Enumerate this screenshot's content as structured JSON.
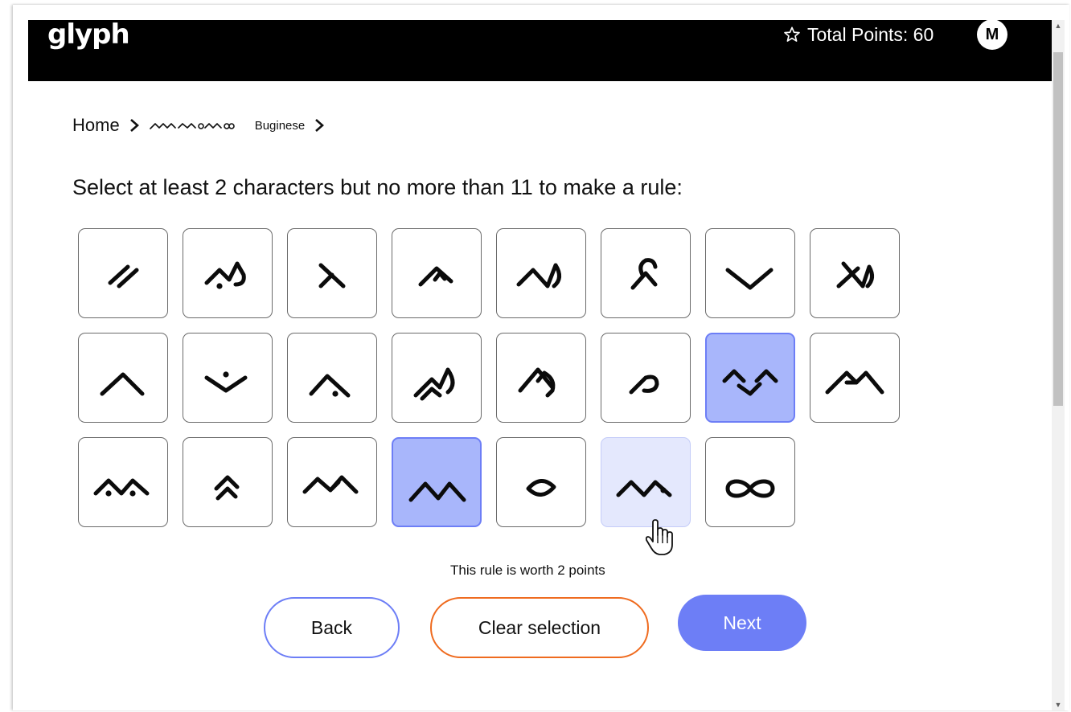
{
  "header": {
    "logo": "glyph",
    "points_label": "Total Points: 60",
    "avatar_initial": "M",
    "star_icon": "star-outline-icon"
  },
  "breadcrumb": {
    "home": "Home",
    "script_native": "ᨔᨗᨀᨘᨍᨁᨙ",
    "script_name": "Buginese",
    "chevron_icon": "chevron-right-icon"
  },
  "instruction": "Select at least 2 characters but no more than 11 to make a rule:",
  "tiles": [
    {
      "glyph": "double-slash",
      "state": "default"
    },
    {
      "glyph": "dot-hook",
      "state": "default"
    },
    {
      "glyph": "lambda",
      "state": "default"
    },
    {
      "glyph": "arrow-hat",
      "state": "default"
    },
    {
      "glyph": "wave-hook",
      "state": "default"
    },
    {
      "glyph": "loop-lambda",
      "state": "default"
    },
    {
      "glyph": "vee",
      "state": "default"
    },
    {
      "glyph": "lambda-hook",
      "state": "default"
    },
    {
      "glyph": "caret",
      "state": "default"
    },
    {
      "glyph": "dot-vee",
      "state": "default"
    },
    {
      "glyph": "caret-dot",
      "state": "default"
    },
    {
      "glyph": "double-hook",
      "state": "default"
    },
    {
      "glyph": "loop-hook",
      "state": "default"
    },
    {
      "glyph": "small-loop",
      "state": "default"
    },
    {
      "glyph": "wave-vee",
      "state": "selected"
    },
    {
      "glyph": "double-peak",
      "state": "default"
    },
    {
      "glyph": "peaks-two-dots",
      "state": "default"
    },
    {
      "glyph": "double-chevron",
      "state": "default"
    },
    {
      "glyph": "wave-loop",
      "state": "default"
    },
    {
      "glyph": "m-peaks",
      "state": "selected"
    },
    {
      "glyph": "diamond",
      "state": "default"
    },
    {
      "glyph": "peaks-dot",
      "state": "hover"
    },
    {
      "glyph": "infinity",
      "state": "default"
    }
  ],
  "worth_text": "This rule is worth 2 points",
  "buttons": {
    "back": "Back",
    "clear": "Clear selection",
    "next": "Next"
  },
  "colors": {
    "selected": "#a8b6fb",
    "accent": "#6d7ef6",
    "clear_border": "#ef6b1f",
    "header_bg": "#000000"
  }
}
